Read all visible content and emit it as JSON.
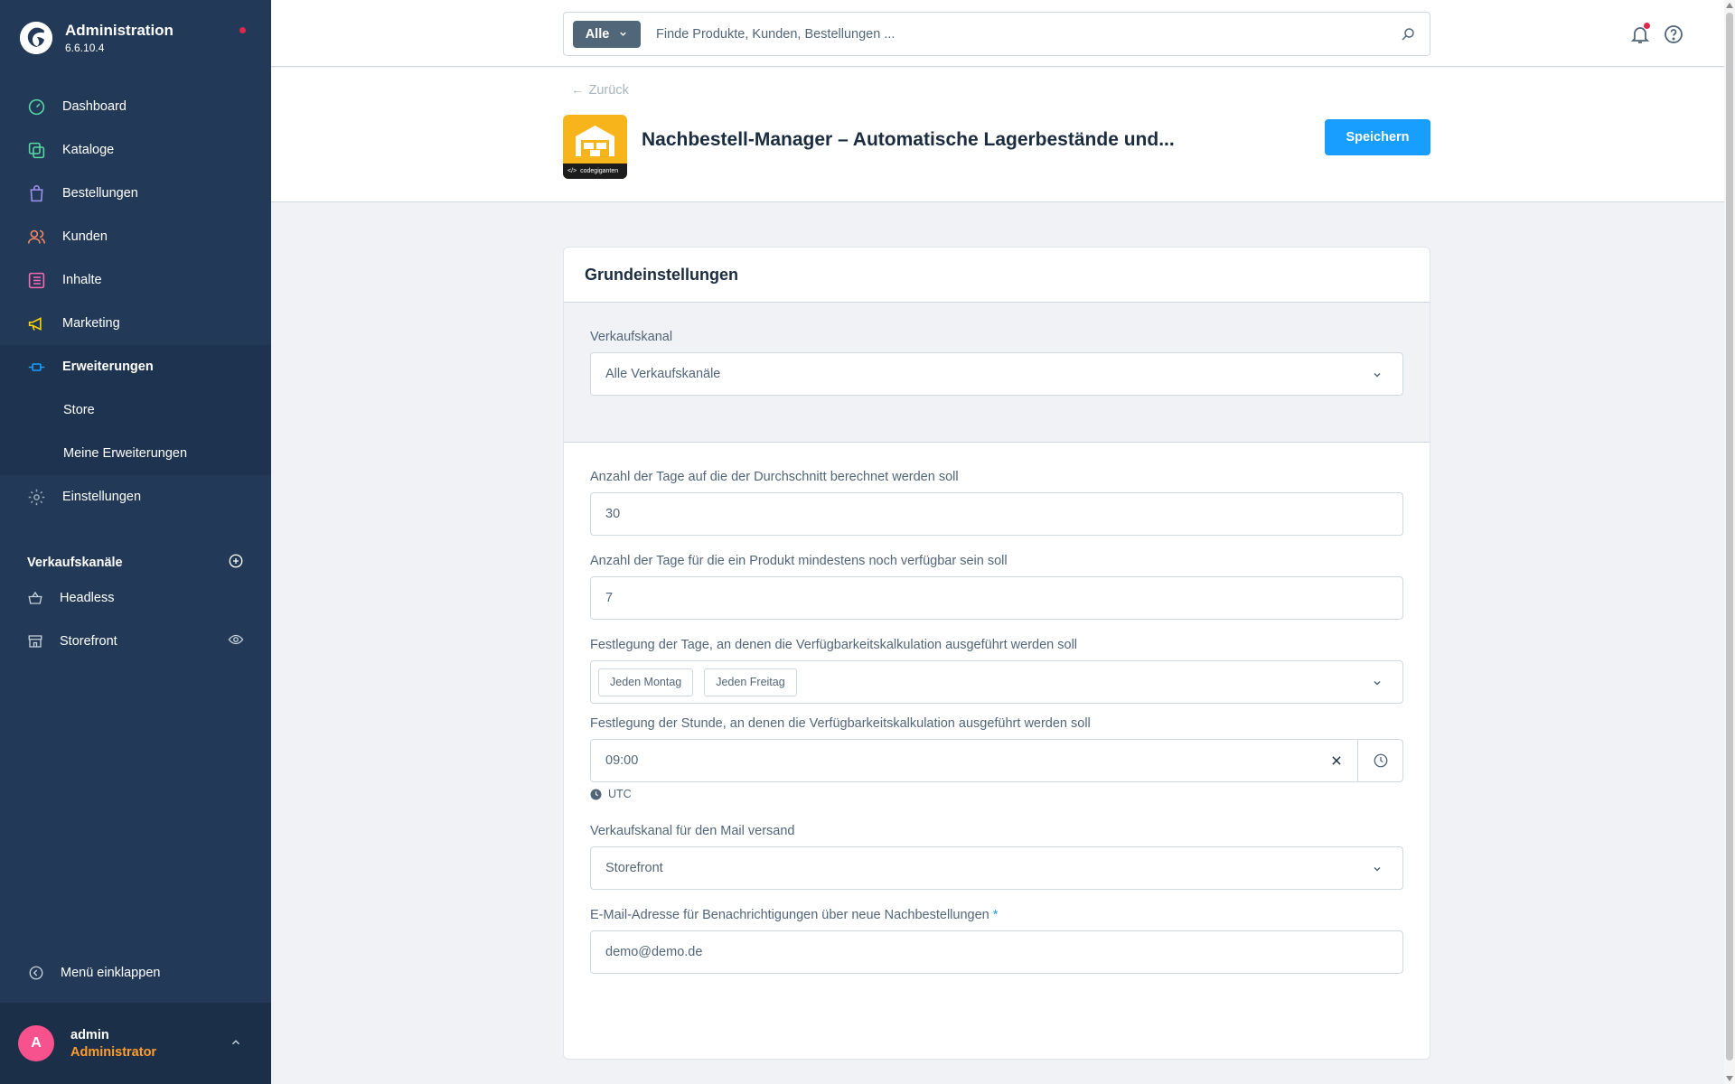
{
  "sidebar": {
    "brand_title": "Administration",
    "brand_version": "6.6.10.4",
    "items": [
      {
        "label": "Dashboard",
        "icon": "dashboard-icon",
        "color": "#57d9a3"
      },
      {
        "label": "Kataloge",
        "icon": "catalog-icon",
        "color": "#57d9a3"
      },
      {
        "label": "Bestellungen",
        "icon": "bag-icon",
        "color": "#a092f0"
      },
      {
        "label": "Kunden",
        "icon": "users-icon",
        "color": "#f88962"
      },
      {
        "label": "Inhalte",
        "icon": "content-icon",
        "color": "#ff68b4"
      },
      {
        "label": "Marketing",
        "icon": "megaphone-icon",
        "color": "#ffd700"
      },
      {
        "label": "Erweiterungen",
        "icon": "plug-icon",
        "color": "#189eff"
      },
      {
        "label": "Einstellungen",
        "icon": "gear-icon",
        "color": "#9aa8b5"
      }
    ],
    "sub_items": [
      "Store",
      "Meine Erweiterungen"
    ],
    "sales_channels_title": "Verkaufskanäle",
    "sales_channels": [
      {
        "label": "Headless",
        "icon": "basket-icon"
      },
      {
        "label": "Storefront",
        "icon": "storefront-icon"
      }
    ],
    "collapse_label": "Menü einklappen",
    "user": {
      "initial": "A",
      "name": "admin",
      "role": "Administrator"
    }
  },
  "header": {
    "search_type": "Alle",
    "search_placeholder": "Finde Produkte, Kunden, Bestellungen ..."
  },
  "smartbar": {
    "back_label": "Zurück",
    "title": "Nachbestell-Manager – Automatische Lagerbestände und...",
    "save_label": "Speichern",
    "logo_text": "codegiganten"
  },
  "card": {
    "title": "Grundeinstellungen",
    "sales_channel_label": "Verkaufskanal",
    "sales_channel_value": "Alle Verkaufskanäle",
    "fields": {
      "avg_days_label": "Anzahl der Tage auf die der Durchschnitt berechnet werden soll",
      "avg_days_value": "30",
      "min_days_label": "Anzahl der Tage für die ein Produkt mindestens noch verfügbar sein soll",
      "min_days_value": "7",
      "weekdays_label": "Festlegung der Tage, an denen die Verfügbarkeitskalkulation ausgeführt werden soll",
      "weekdays": [
        "Jeden Montag",
        "Jeden Freitag"
      ],
      "hour_label": "Festlegung der Stunde, an denen die Verfügbarkeitskalkulation ausgeführt werden soll",
      "hour_value": "09:00",
      "timezone": "UTC",
      "mail_channel_label": "Verkaufskanal für den Mail versand",
      "mail_channel_value": "Storefront",
      "email_label": "E-Mail-Adresse für Benachrichtigungen über neue Nachbestellungen",
      "email_required_mark": "*",
      "email_value": "demo@demo.de"
    }
  }
}
